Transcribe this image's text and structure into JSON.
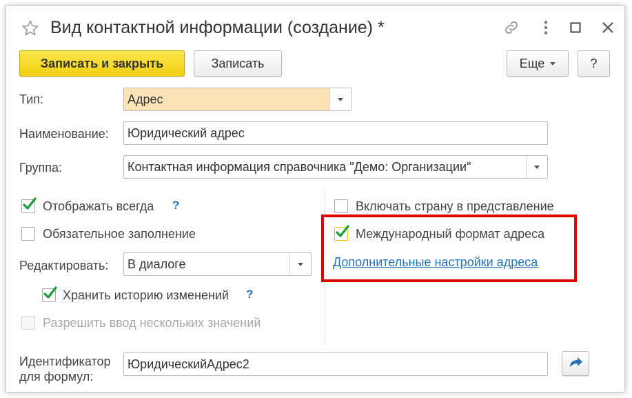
{
  "window": {
    "title": "Вид контактной информации (создание) *",
    "icons": [
      "star-icon",
      "link-icon",
      "more-vertical-icon",
      "maximize-icon",
      "close-icon"
    ]
  },
  "toolbar": {
    "save_close_label": "Записать и закрыть",
    "save_label": "Записать",
    "more_label": "Еще",
    "help_label": "?"
  },
  "form": {
    "type": {
      "label": "Тип:",
      "value": "Адрес"
    },
    "name": {
      "label": "Наименование:",
      "value": "Юридический адрес"
    },
    "group": {
      "label": "Группа:",
      "value": "Контактная информация справочника \"Демо: Организации\""
    },
    "show_always": {
      "label": "Отображать всегда",
      "checked": true,
      "help": "?"
    },
    "required": {
      "label": "Обязательное заполнение",
      "checked": false
    },
    "edit": {
      "label": "Редактировать:",
      "value": "В диалоге"
    },
    "keep_history": {
      "label": "Хранить историю изменений",
      "checked": true,
      "help": "?"
    },
    "allow_multiple": {
      "label": "Разрешить ввод нескольких значений",
      "checked": false,
      "disabled": true
    },
    "include_country": {
      "label": "Включать страну в представление",
      "checked": false
    },
    "intl_format": {
      "label": "Международный формат адреса",
      "checked": true
    },
    "extra_settings_link": "Дополнительные настройки адреса",
    "identifier": {
      "label_line1": "Идентификатор",
      "label_line2": "для формул:",
      "value": "ЮридическийАдрес2"
    }
  },
  "colors": {
    "accent_yellow": "#f5d31c",
    "highlight_field": "#fce3b7",
    "link": "#2773b8",
    "check_green": "#1a9c3a",
    "red_highlight": "#e00000"
  }
}
